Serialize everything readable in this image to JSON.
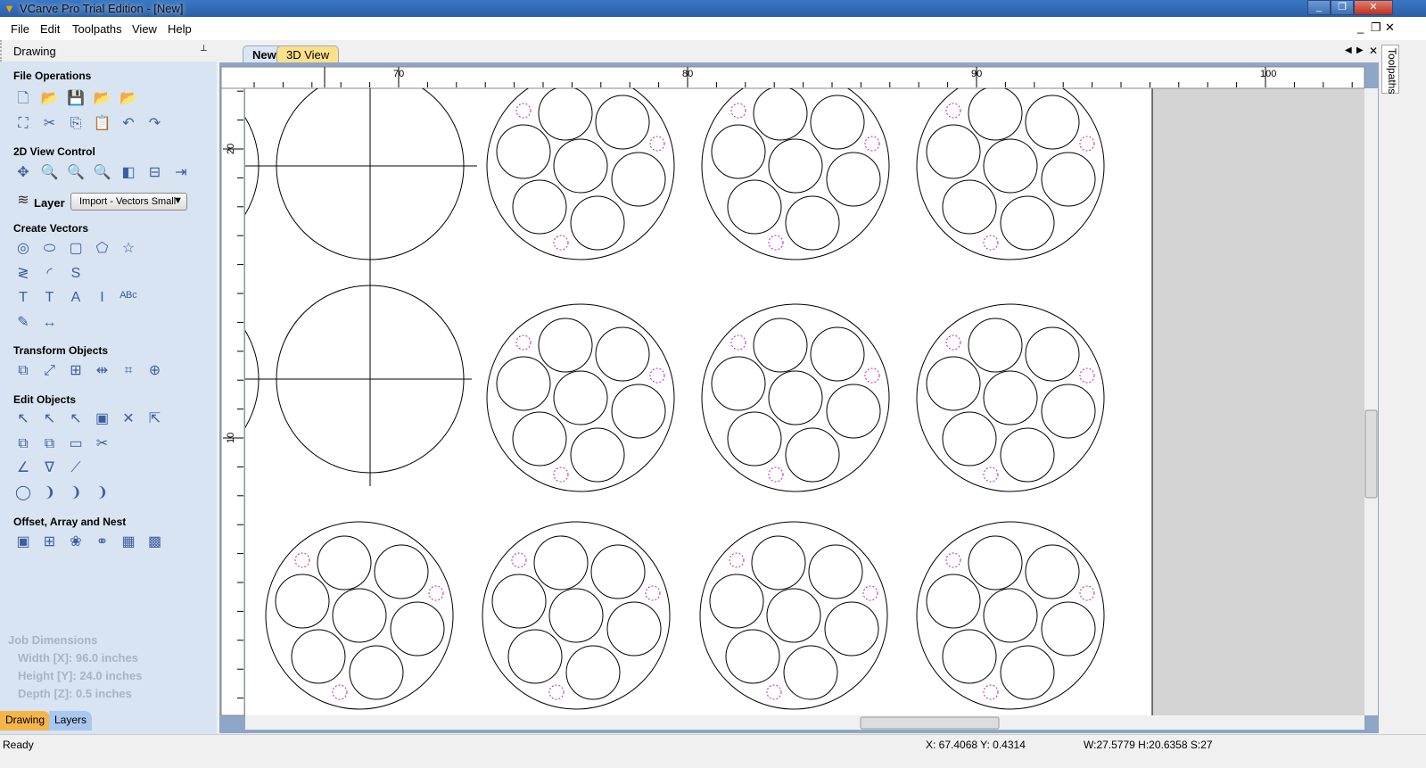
{
  "window": {
    "title": "VCarve Pro Trial Edition - [New]",
    "min": "_",
    "max": "❐",
    "close": "✕"
  },
  "menu": [
    "File",
    "Edit",
    "Toolpaths",
    "View",
    "Help"
  ],
  "mdi_buttons": {
    "min": "_",
    "restore": "❐",
    "close": "✕"
  },
  "panel": {
    "title": "Drawing",
    "pin": "📌",
    "sections": {
      "file": "File Operations",
      "view": "2D View Control",
      "create": "Create Vectors",
      "transform": "Transform Objects",
      "edit": "Edit Objects",
      "offset": "Offset, Array and Nest"
    },
    "layer_label": "Layer",
    "layer_value": "Import - Vectors Small",
    "icons": {
      "file": [
        [
          "new-file-icon",
          "🗋"
        ],
        [
          "open-folder-icon",
          "📂"
        ],
        [
          "save-icon",
          "💾"
        ],
        [
          "open-recent-icon",
          "📂"
        ],
        [
          "import-icon",
          "📂"
        ],
        [
          "select-all-icon",
          "⛶"
        ],
        [
          "cut-icon",
          "✂"
        ],
        [
          "copy-icon",
          "⎘"
        ],
        [
          "paste-icon",
          "📋"
        ],
        [
          "undo-icon",
          "↶"
        ],
        [
          "redo-icon",
          "↷"
        ]
      ],
      "view": [
        [
          "pan-icon",
          "✥"
        ],
        [
          "zoom-icon",
          "🔍"
        ],
        [
          "zoom-extents-icon",
          "🔍"
        ],
        [
          "zoom-selection-icon",
          "🔍"
        ],
        [
          "view-left-icon",
          "◧"
        ],
        [
          "view-middle-icon",
          "⊟"
        ],
        [
          "view-right-icon",
          "⇥"
        ]
      ],
      "create": [
        [
          "circle-icon",
          "◎"
        ],
        [
          "ellipse-icon",
          "⬭"
        ],
        [
          "rectangle-icon",
          "▢"
        ],
        [
          "polygon-icon",
          "⬠"
        ],
        [
          "star-icon",
          "☆"
        ],
        [
          "polyline-icon",
          "≷"
        ],
        [
          "arc-icon",
          "◜"
        ],
        [
          "curve-icon",
          "S"
        ],
        [
          "text-icon",
          "T"
        ],
        [
          "text-box-icon",
          "T"
        ],
        [
          "text-on-curve-icon",
          "A"
        ],
        [
          "text-fit-icon",
          "I"
        ],
        [
          "text-arc-icon",
          "ᴬᴮᶜ"
        ],
        [
          "bitmap-trace-icon",
          "✎"
        ],
        [
          "dimension-icon",
          "↔"
        ]
      ],
      "transform": [
        [
          "move-icon",
          "⧉"
        ],
        [
          "scale-icon",
          "⤢"
        ],
        [
          "align-icon",
          "⊞"
        ],
        [
          "mirror-icon",
          "⇹"
        ],
        [
          "distort-icon",
          "⌗"
        ],
        [
          "center-icon",
          "⊕"
        ]
      ],
      "edit": [
        [
          "select-icon",
          "↖"
        ],
        [
          "node-edit-icon",
          "↖"
        ],
        [
          "interactive-select-icon",
          "↖"
        ],
        [
          "group-icon",
          "▣"
        ],
        [
          "ungroup-icon",
          "✕"
        ],
        [
          "measure-icon",
          "⇱"
        ],
        [
          "weld-icon",
          "⧉"
        ],
        [
          "subtract-icon",
          "⧉"
        ],
        [
          "trim-icon",
          "▭"
        ],
        [
          "scissors-icon",
          "✂"
        ],
        [
          "fillet-icon",
          "∠"
        ],
        [
          "chamfer-icon",
          "∇"
        ],
        [
          "extend-icon",
          "⟋"
        ],
        [
          "join-icon",
          "◯"
        ],
        [
          "close-vector-icon",
          "❩"
        ],
        [
          "curve-fit-icon",
          "❩"
        ],
        [
          "smooth-icon",
          "❩"
        ]
      ],
      "offset": [
        [
          "offset-icon",
          "▣"
        ],
        [
          "array-icon",
          "⊞"
        ],
        [
          "circular-array-icon",
          "❀"
        ],
        [
          "step-repeat-icon",
          "⚭"
        ],
        [
          "nest-icon",
          "▦"
        ],
        [
          "nest-parts-icon",
          "▩"
        ]
      ]
    },
    "job": {
      "title": "Job Dimensions",
      "width": "Width  [X]: 96.0 inches",
      "height": "Height [Y]: 24.0 inches",
      "depth": "Depth  [Z]: 0.5 inches"
    },
    "tabs": [
      "Drawing",
      "Layers"
    ]
  },
  "doc_tabs": [
    "New",
    "3D View"
  ],
  "right_tab": "Toolpaths",
  "rulers": {
    "x_labels": [
      70,
      80,
      90,
      100
    ],
    "y_labels": [
      20,
      10
    ]
  },
  "colors": {
    "vector": "#000000",
    "selected_dashed": "#c020c0",
    "sheet": "#ffffff",
    "outside": "#d4d4d4"
  },
  "status": {
    "text": "Ready",
    "coords": "X: 67.4068 Y:  0.4314",
    "size": "W:27.5779   H:20.6358  S:27"
  }
}
